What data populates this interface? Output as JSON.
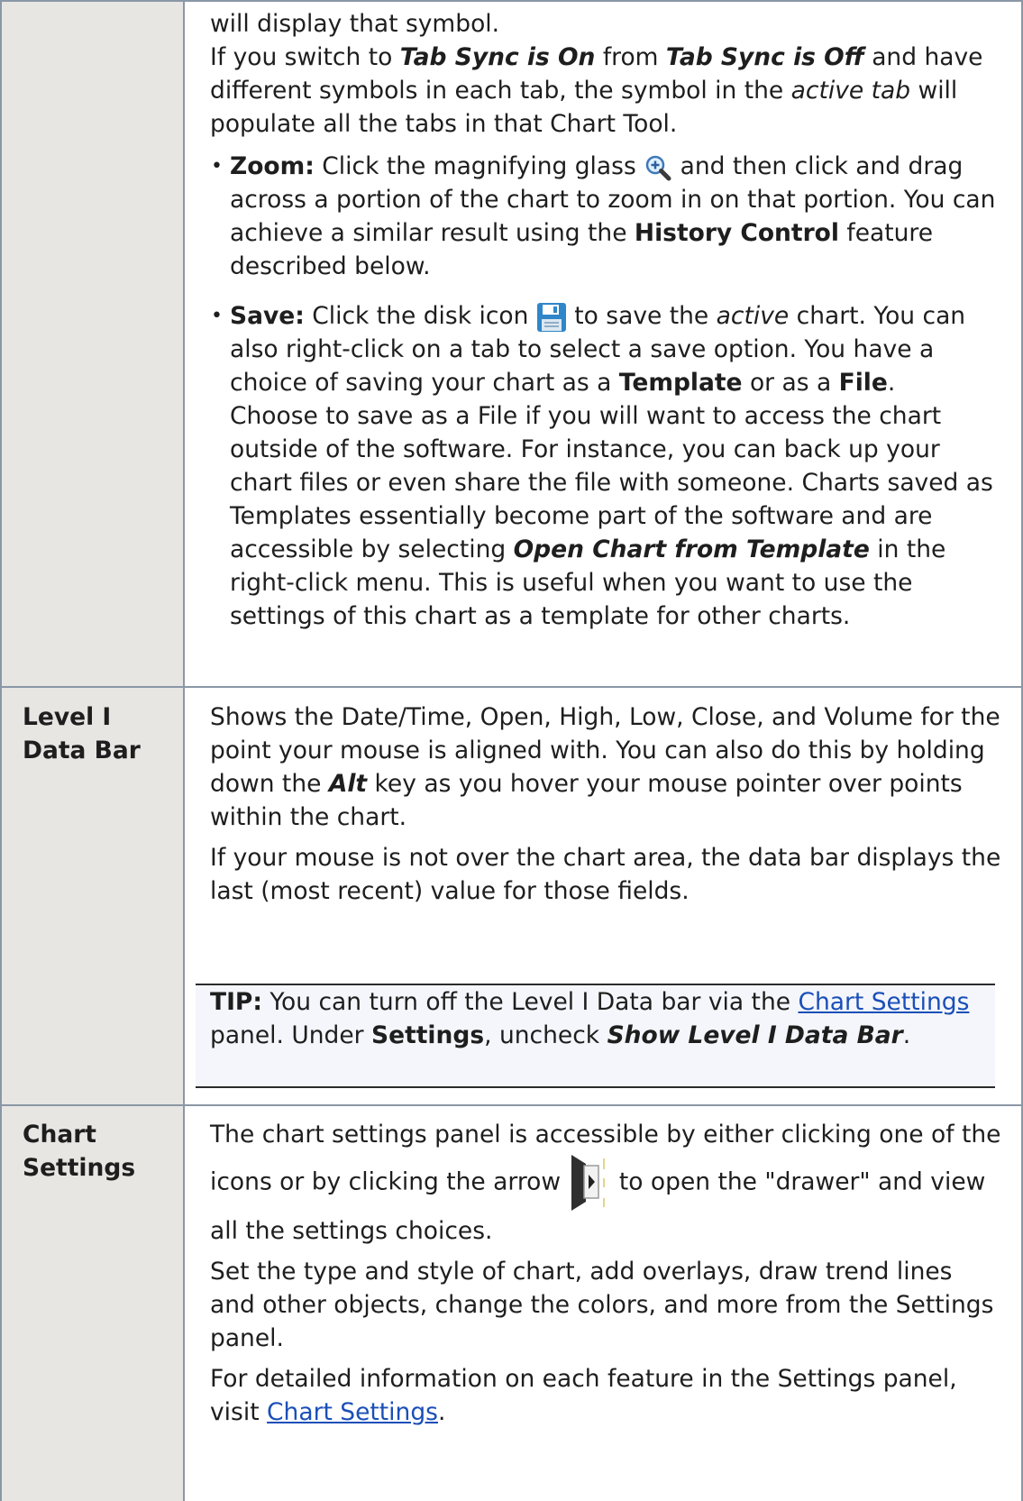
{
  "row1": {
    "lead_line": "will display that symbol.",
    "sync": {
      "t1": "If you switch to ",
      "on": "Tab Sync is On",
      "t2": " from ",
      "off": "Tab Sync is Off",
      "t3": " and have different symbols in each tab, the symbol in the ",
      "active": "active tab",
      "t4": " will populate all the tabs in that Chart Tool."
    },
    "zoom": {
      "label": "Zoom:",
      "t1": " Click the magnifying glass ",
      "t2": " and then click and drag across a portion of the chart to zoom in on that portion. You can achieve a similar result using the ",
      "history": "History Control",
      "t3": " feature described below.",
      "icon": "magnifying-glass-icon"
    },
    "save": {
      "label": "Save:",
      "t1": " Click the disk icon ",
      "t2": " to save the ",
      "active": "active",
      "t3": " chart. You can also right-click on a tab to select a save option. You have a choice of saving your chart as a ",
      "template": "Template",
      "t4": " or as a ",
      "file": "File",
      "t5": ".",
      "icon": "disk-icon",
      "choose_t1": "Choose to save as a File if you will want to access the chart outside of the software. For instance, you can back up your chart files or even share the file with someone. Charts saved as Templates essentially become part of the software and are accessible by selecting ",
      "open_from_template": "Open Chart from Template",
      "choose_t2": " in the right-click menu. This is useful when you want to use the settings of this chart as a template for other charts."
    }
  },
  "row2": {
    "label": "Level I Data Bar",
    "p1_t1": "Shows the Date/Time, Open, High, Low, Close, and Volume for the point your mouse is aligned with. You can also do this by holding down the ",
    "alt": "Alt",
    "p1_t2": " key as you hover your mouse pointer over points within the chart.",
    "p2": "If your mouse is not over the chart area, the data bar displays the last (most recent) value for those fields.",
    "tip": {
      "tip_label": "TIP:",
      "t1": " You can turn off the Level I Data bar via the ",
      "link": "Chart Settings",
      "t2": " panel. Under ",
      "settings": "Settings",
      "t3": ", uncheck ",
      "show": "Show Level I Data Bar",
      "t4": "."
    }
  },
  "row3": {
    "label": "Chart Settings",
    "p1_t1": "The chart settings panel is accessible by either clicking one of the icons or by clicking the arrow",
    "p1_t2": " to open the \"drawer\" and view all the settings choices.",
    "icon": "drawer-arrow-icon",
    "p2": "Set the type and style of chart, add overlays, draw trend lines and other objects, change the colors, and more from the Settings panel.",
    "p3_t1": "For detailed information on each feature in the Settings panel, visit ",
    "link": "Chart Settings",
    "p3_t2": "."
  },
  "colors": {
    "border": "#8a97a6",
    "left_bg": "#e7e6e3",
    "link": "#1a4fb8",
    "tip_bg": "#f5f6fb"
  }
}
